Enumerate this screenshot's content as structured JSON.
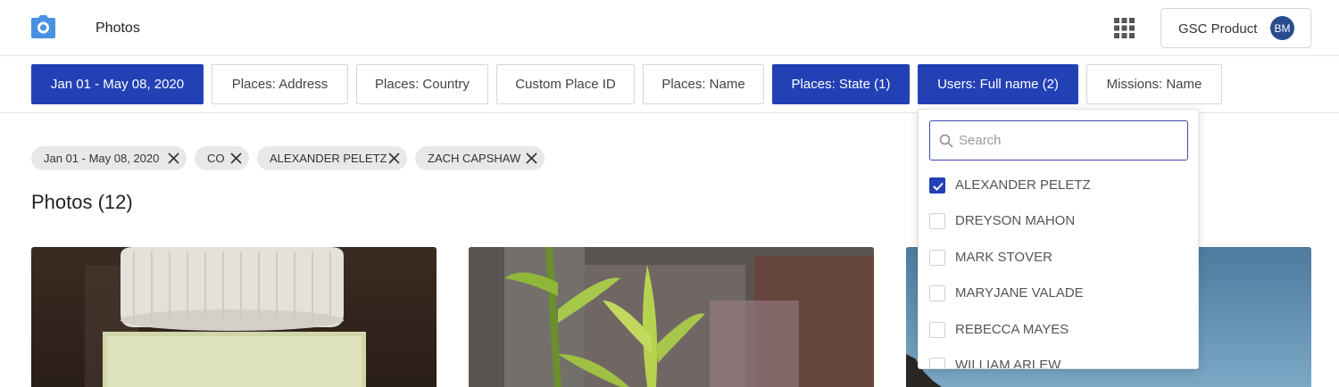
{
  "header": {
    "title": "Photos",
    "account_label": "GSC Product",
    "avatar_initials": "BM",
    "logo_icon": "camera-icon",
    "apps_icon": "grid-apps-icon"
  },
  "filters": [
    {
      "label": "Jan 01 - May 08, 2020",
      "active": true
    },
    {
      "label": "Places: Address",
      "active": false
    },
    {
      "label": "Places: Country",
      "active": false
    },
    {
      "label": "Custom Place ID",
      "active": false
    },
    {
      "label": "Places: Name",
      "active": false
    },
    {
      "label": "Places: State (1)",
      "active": true
    },
    {
      "label": "Users: Full name (2)",
      "active": true
    },
    {
      "label": "Missions: Name",
      "active": false
    }
  ],
  "chips": [
    {
      "label": "Jan 01 - May 08, 2020"
    },
    {
      "label": "CO"
    },
    {
      "label": "ALEXANDER PELETZ"
    },
    {
      "label": "ZACH CAPSHAW"
    }
  ],
  "section": {
    "title": "Photos (12)"
  },
  "dropdown": {
    "search_placeholder": "Search",
    "options": [
      {
        "label": "ALEXANDER PELETZ",
        "checked": true
      },
      {
        "label": "DREYSON MAHON",
        "checked": false
      },
      {
        "label": "MARK STOVER",
        "checked": false
      },
      {
        "label": "MARYJANE VALADE",
        "checked": false
      },
      {
        "label": "REBECCA MAYES",
        "checked": false
      },
      {
        "label": "WILLIAM ARLEW",
        "checked": false
      }
    ]
  },
  "colors": {
    "accent": "#2340b4",
    "logo": "#4a90e2",
    "avatar": "#2a4c8f",
    "chip_bg": "#e8e8e8"
  }
}
